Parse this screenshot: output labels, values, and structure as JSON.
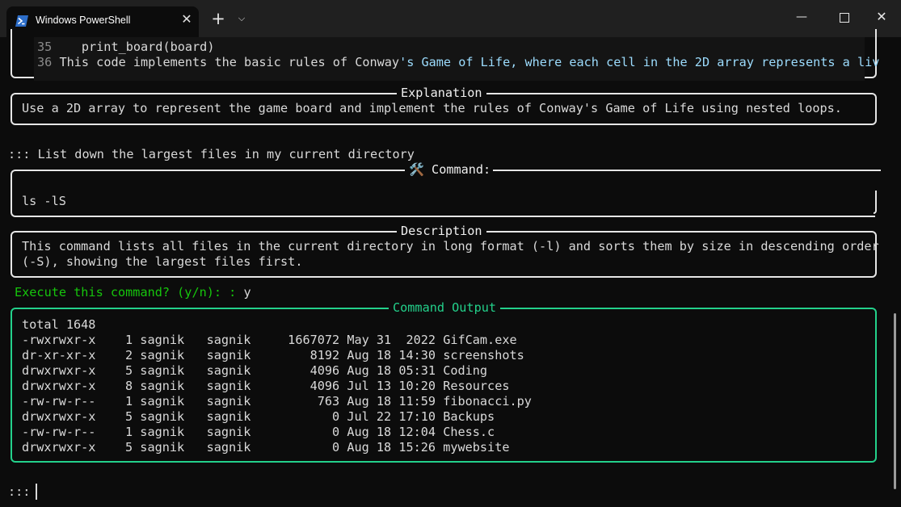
{
  "window": {
    "tab_title": "Windows PowerShell",
    "tab_icon": "powershell-icon",
    "new_tab_symbol": "+",
    "dropdown_symbol": "⌵",
    "minimize_symbol": "—",
    "close_symbol": "✕",
    "tab_close_symbol": "✕"
  },
  "code_block": {
    "lines": [
      {
        "num": "35",
        "text": "    print_board(board)"
      },
      {
        "num": "36",
        "text_plain": "This code implements the basic rules of Conway",
        "text_hl": "'s Game of Life, where each cell in the 2D array represents a liv"
      }
    ]
  },
  "explanation": {
    "title": "Explanation",
    "text": "Use a 2D array to represent the game board and implement the rules of Conway's Game of Life using nested loops."
  },
  "prompt": {
    "prefix": ":::",
    "query": "List down the largest files in my current directory"
  },
  "command": {
    "title": "🛠️ Command:",
    "text": "ls -lS"
  },
  "description": {
    "title": "Description",
    "line1": "This command lists all files in the current directory in long format (-l) and sorts them by size in descending order",
    "line2": "(-S), showing the largest files first."
  },
  "execute_prompt": {
    "label": "Execute this command? (y/n): :",
    "answer": "y"
  },
  "output": {
    "title": "Command Output",
    "total": "total 1648",
    "rows": [
      "-rwxrwxr-x    1 sagnik   sagnik     1667072 May 31  2022 GifCam.exe",
      "dr-xr-xr-x    2 sagnik   sagnik        8192 Aug 18 14:30 screenshots",
      "drwxrwxr-x    5 sagnik   sagnik        4096 Aug 18 05:31 Coding",
      "drwxrwxr-x    8 sagnik   sagnik        4096 Jul 13 10:20 Resources",
      "-rw-rw-r--    1 sagnik   sagnik         763 Aug 18 11:59 fibonacci.py",
      "drwxrwxr-x    5 sagnik   sagnik           0 Jul 22 17:10 Backups",
      "-rw-rw-r--    1 sagnik   sagnik           0 Aug 18 12:04 Chess.c",
      "drwxrwxr-x    5 sagnik   sagnik           0 Aug 18 15:26 mywebsite"
    ]
  },
  "final_prompt": ":::",
  "colors": {
    "background": "#0c0c0c",
    "titlebar": "#202020",
    "accent_green": "#23d18b",
    "prompt_green": "#16c60c"
  }
}
